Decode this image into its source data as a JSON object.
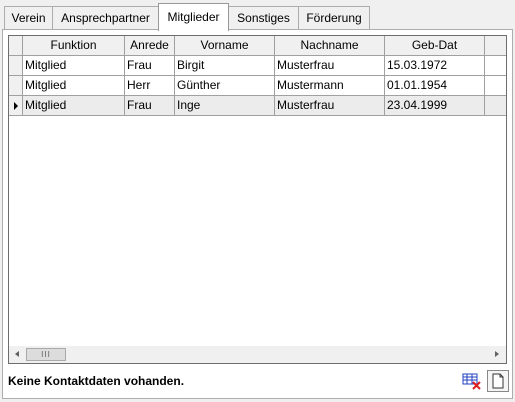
{
  "tabs": [
    {
      "label": "Verein"
    },
    {
      "label": "Ansprechpartner"
    },
    {
      "label": "Mitglieder"
    },
    {
      "label": "Sonstiges"
    },
    {
      "label": "Förderung"
    }
  ],
  "active_tab": "Mitglieder",
  "grid": {
    "columns": [
      "Funktion",
      "Anrede",
      "Vorname",
      "Nachname",
      "Geb-Dat"
    ],
    "rows": [
      {
        "funktion": "Mitglied",
        "anrede": "Frau",
        "vorname": "Birgit",
        "nachname": "Musterfrau",
        "geb_dat": "15.03.1972"
      },
      {
        "funktion": "Mitglied",
        "anrede": "Herr",
        "vorname": "Günther",
        "nachname": "Mustermann",
        "geb_dat": "01.01.1954"
      },
      {
        "funktion": "Mitglied",
        "anrede": "Frau",
        "vorname": "Inge",
        "nachname": "Musterfrau",
        "geb_dat": "23.04.1999"
      }
    ],
    "scroll_thumb_grip": "III"
  },
  "status_text": "Keine Kontaktdaten vohanden.",
  "icons": {
    "clear_contacts": "clear-grid-icon",
    "new_document": "new-document-icon"
  },
  "colors": {
    "delete_accent": "#e02020",
    "grid_accent": "#2040c0"
  }
}
